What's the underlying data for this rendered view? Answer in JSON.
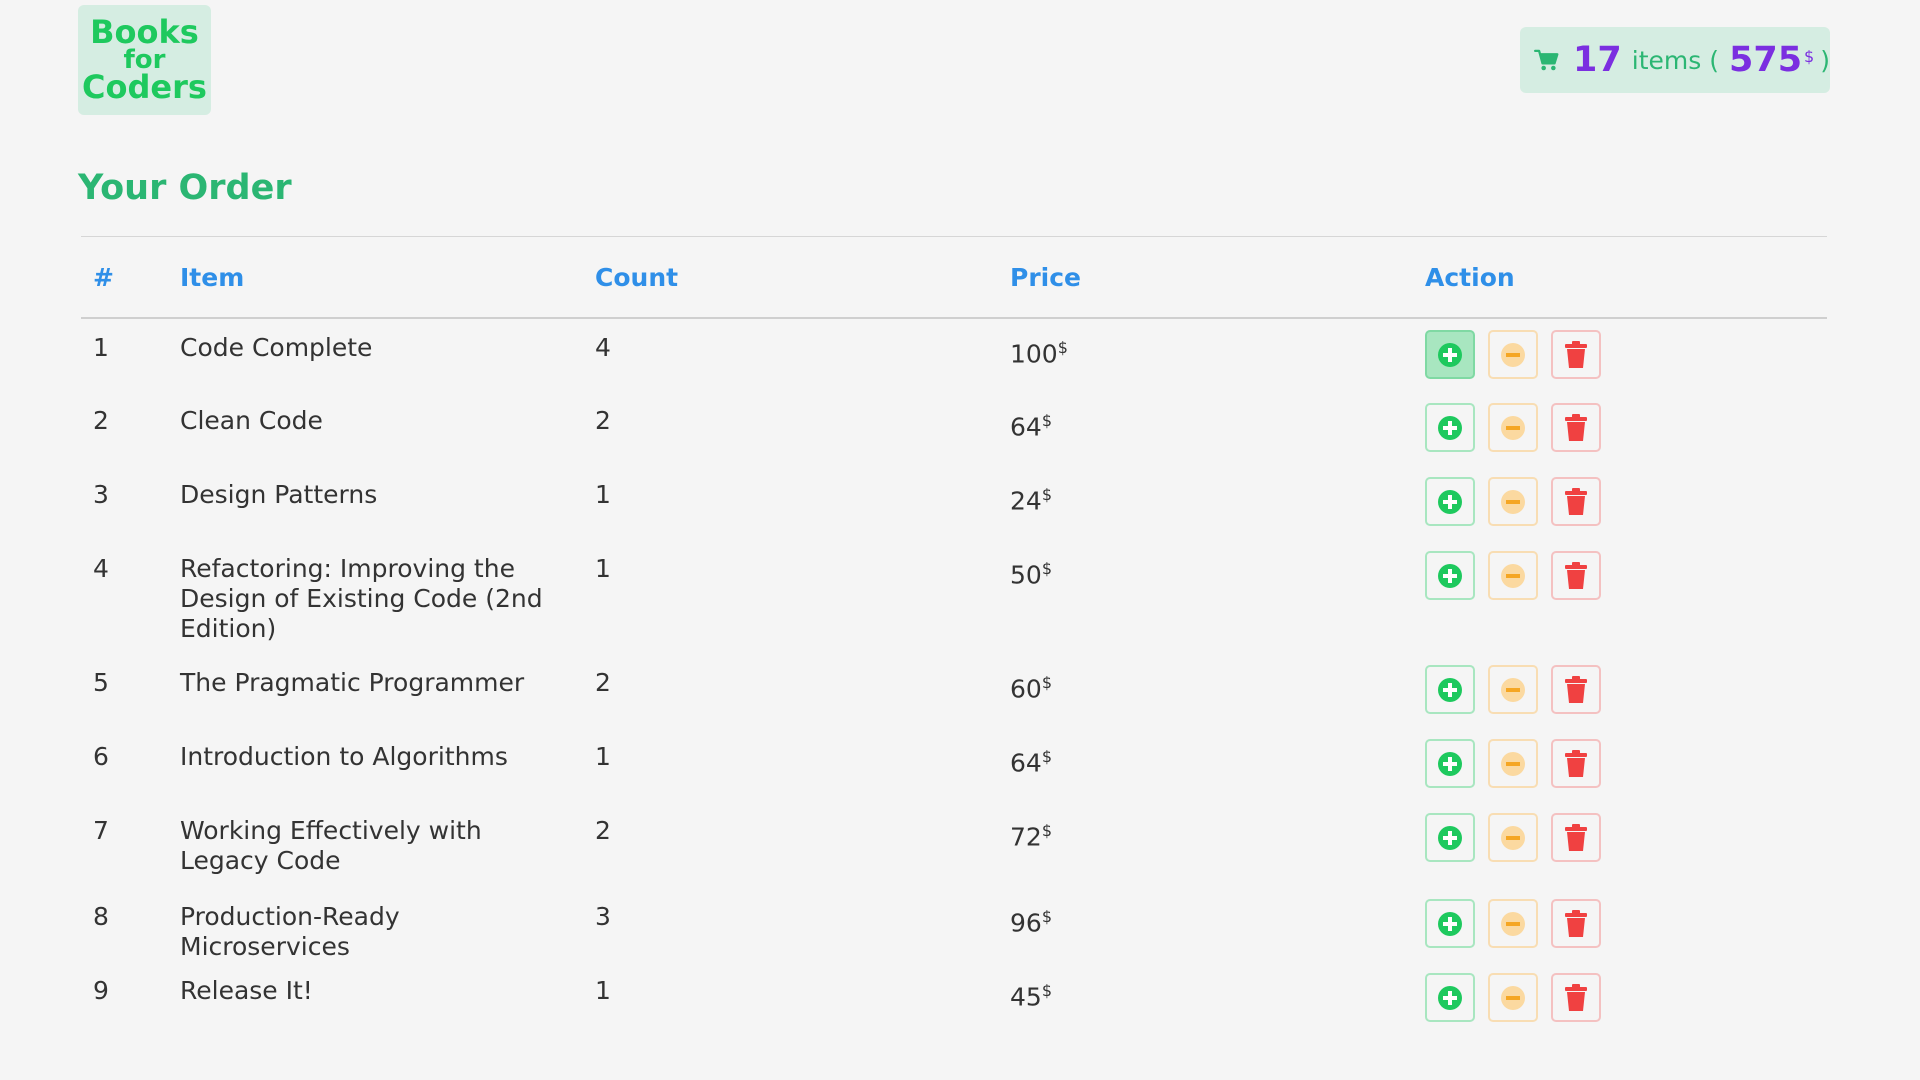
{
  "brand": {
    "line1": "Books",
    "line2": "for",
    "line3": "Coders"
  },
  "cart": {
    "icon": "shopping-cart-icon",
    "count": "17",
    "items_label": "items (",
    "total": "575",
    "currency": "$",
    "close_paren": ")"
  },
  "page_title": "Your Order",
  "table": {
    "headers": {
      "num": "#",
      "item": "Item",
      "count": "Count",
      "price": "Price",
      "action": "Action"
    },
    "currency": "$",
    "rows": [
      {
        "num": "1",
        "item": "Code Complete",
        "count": "4",
        "price": "100"
      },
      {
        "num": "2",
        "item": "Clean Code",
        "count": "2",
        "price": "64"
      },
      {
        "num": "3",
        "item": "Design Patterns",
        "count": "1",
        "price": "24"
      },
      {
        "num": "4",
        "item": "Refactoring: Improving the Design of Existing Code (2nd Edition)",
        "count": "1",
        "price": "50"
      },
      {
        "num": "5",
        "item": "The Pragmatic Programmer",
        "count": "2",
        "price": "60"
      },
      {
        "num": "6",
        "item": "Introduction to Algorithms",
        "count": "1",
        "price": "64"
      },
      {
        "num": "7",
        "item": "Working Effectively with Legacy Code",
        "count": "2",
        "price": "72"
      },
      {
        "num": "8",
        "item": "Production-Ready Microservices",
        "count": "3",
        "price": "96"
      },
      {
        "num": "9",
        "item": "Release It!",
        "count": "1",
        "price": "45"
      }
    ],
    "action_icons": [
      "plus-circle-icon",
      "minus-circle-icon",
      "trash-icon"
    ]
  },
  "colors": {
    "brand_green": "#1ec95e",
    "accent_green": "#2bb673",
    "purple": "#7b2fe0",
    "header_blue": "#2f8fe8",
    "add_green": "#1ec95e",
    "minus_orange": "#f5a623",
    "delete_red": "#f04141"
  }
}
